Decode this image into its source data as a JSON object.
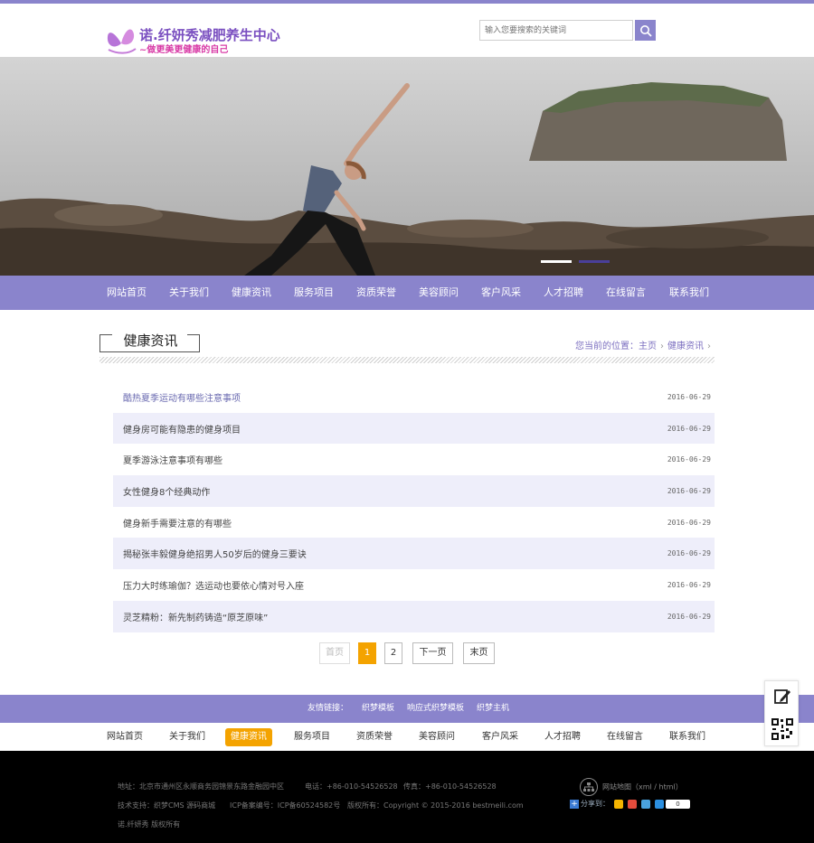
{
  "header": {
    "logo_title": "诺.纤妍秀减肥养生中心",
    "logo_sub": "~做更美更健康的自己",
    "search_placeholder": "输入您要搜索的关键词"
  },
  "nav": [
    "网站首页",
    "关于我们",
    "健康资讯",
    "服务项目",
    "资质荣誉",
    "美容顾问",
    "客户风采",
    "人才招聘",
    "在线留言",
    "联系我们"
  ],
  "section": {
    "title": "健康资讯",
    "crumb_prefix": "您当前的位置：",
    "crumb_home": "主页",
    "crumb_current": "健康资讯"
  },
  "articles": [
    {
      "title": "酷热夏季运动有哪些注意事项",
      "date": "2016-06-29"
    },
    {
      "title": "健身房可能有隐患的健身项目",
      "date": "2016-06-29"
    },
    {
      "title": "夏季游泳注意事项有哪些",
      "date": "2016-06-29"
    },
    {
      "title": "女性健身8个经典动作",
      "date": "2016-06-29"
    },
    {
      "title": "健身新手需要注意的有哪些",
      "date": "2016-06-29"
    },
    {
      "title": "揭秘张丰毅健身绝招男人50岁后的健身三要诀",
      "date": "2016-06-29"
    },
    {
      "title": "压力大时练瑜伽？选运动也要依心情对号入座",
      "date": "2016-06-29"
    },
    {
      "title": "灵芝精粉：新先制药铸造“原芝原味”",
      "date": "2016-06-29"
    }
  ],
  "pager": {
    "first": "首页",
    "page1": "1",
    "page2": "2",
    "next": "下一页",
    "last": "末页"
  },
  "friend": {
    "label": "友情链接：",
    "links": [
      "织梦模板",
      "响应式织梦模板",
      "织梦主机"
    ]
  },
  "footer": {
    "address": "地址：北京市通州区永顺商务园锦景东路金融园中区",
    "phone": "电话：+86-010-54526528",
    "fax": "传真：+86-010-54526528",
    "support": "技术支持：织梦CMS 源码商城",
    "icp": "ICP备案编号：ICP备60524582号",
    "copyright": "版权所有：Copyright © 2015-2016 bestmeili.com",
    "owner": "诺.纤妍秀 版权所有",
    "sitemap": "网站地图（xml / html）",
    "share_label": "分享到：",
    "share_count": "0"
  },
  "colors": {
    "accent": "#8a84cc",
    "active": "#f4a300",
    "row_alt": "#eeeefa",
    "footer_bg": "#000000"
  }
}
